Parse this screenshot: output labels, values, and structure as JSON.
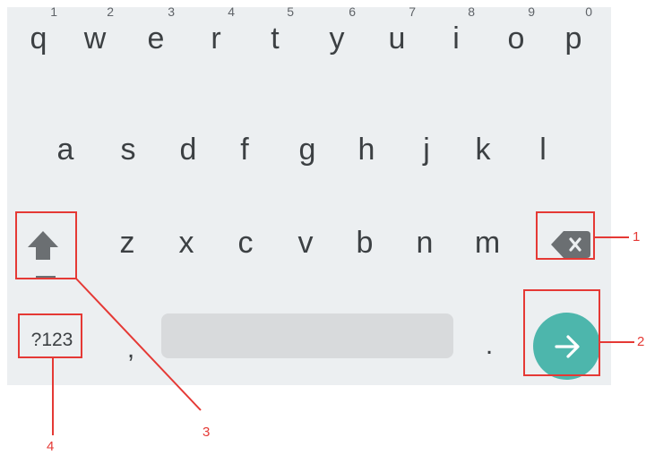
{
  "keyboard": {
    "row1": [
      {
        "key": "q",
        "hint": "1"
      },
      {
        "key": "w",
        "hint": "2"
      },
      {
        "key": "e",
        "hint": "3"
      },
      {
        "key": "r",
        "hint": "4"
      },
      {
        "key": "t",
        "hint": "5"
      },
      {
        "key": "y",
        "hint": "6"
      },
      {
        "key": "u",
        "hint": "7"
      },
      {
        "key": "i",
        "hint": "8"
      },
      {
        "key": "o",
        "hint": "9"
      },
      {
        "key": "p",
        "hint": "0"
      }
    ],
    "row2": [
      "a",
      "s",
      "d",
      "f",
      "g",
      "h",
      "j",
      "k",
      "l"
    ],
    "row3": [
      "z",
      "x",
      "c",
      "v",
      "b",
      "n",
      "m"
    ],
    "symbols_label": "?123",
    "comma_label": ",",
    "period_label": ".",
    "icons": {
      "shift": "shift-arrow-icon",
      "backspace": "backspace-icon",
      "enter": "arrow-right-icon"
    },
    "colors": {
      "background": "#eceff1",
      "key_text": "#3c4043",
      "spacebar": "#d8dadc",
      "enter_button": "#4db6ac",
      "callout": "#e53935"
    }
  },
  "callouts": {
    "backspace": "1",
    "enter": "2",
    "shift": "3",
    "symbols": "4"
  }
}
